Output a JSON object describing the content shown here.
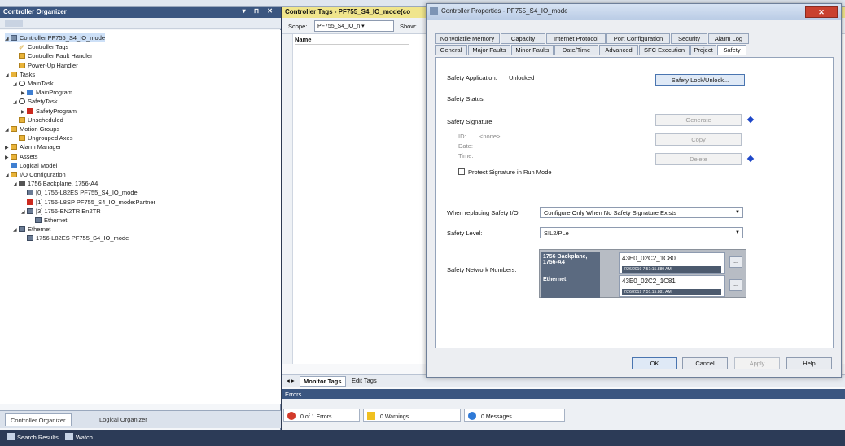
{
  "organizer": {
    "title": "Controller Organizer",
    "tree": [
      {
        "label": "Controller PF755_S4_IO_mode",
        "icon": "controller-icon",
        "level": 0,
        "expander": "◢",
        "selected": true
      },
      {
        "label": "Controller Tags",
        "icon": "tag-icon",
        "level": 1
      },
      {
        "label": "Controller Fault Handler",
        "icon": "folder-icon",
        "level": 1
      },
      {
        "label": "Power-Up Handler",
        "icon": "folder-icon",
        "level": 1
      },
      {
        "label": "Tasks",
        "icon": "folder-icon",
        "level": 0,
        "expander": "◢"
      },
      {
        "label": "MainTask",
        "icon": "task-icon",
        "level": 1,
        "expander": "◢"
      },
      {
        "label": "MainProgram",
        "icon": "program-icon",
        "level": 2,
        "expander": "▶"
      },
      {
        "label": "SafetyTask",
        "icon": "safety-task-icon",
        "level": 1,
        "expander": "◢"
      },
      {
        "label": "SafetyProgram",
        "icon": "safety-program-icon",
        "level": 2,
        "expander": "▶"
      },
      {
        "label": "Unscheduled",
        "icon": "folder-icon",
        "level": 1
      },
      {
        "label": "Motion Groups",
        "icon": "folder-icon",
        "level": 0,
        "expander": "◢"
      },
      {
        "label": "Ungrouped Axes",
        "icon": "folder-icon",
        "level": 1
      },
      {
        "label": "Alarm Manager",
        "icon": "folder-icon",
        "level": 0,
        "expander": "▶"
      },
      {
        "label": "Assets",
        "icon": "folder-icon",
        "level": 0,
        "expander": "▶"
      },
      {
        "label": "Logical Model",
        "icon": "logical-model-icon",
        "level": 0
      },
      {
        "label": "I/O Configuration",
        "icon": "folder-icon",
        "level": 0,
        "expander": "◢"
      },
      {
        "label": "1756 Backplane, 1756-A4",
        "icon": "backplane-icon",
        "level": 1,
        "expander": "◢"
      },
      {
        "label": "[0] 1756-L82ES PF755_S4_IO_mode",
        "icon": "module-icon",
        "level": 2
      },
      {
        "label": "[1] 1756-L8SP PF755_S4_IO_mode:Partner",
        "icon": "safety-module-icon",
        "level": 2
      },
      {
        "label": "[3] 1756-EN2TR En2TR",
        "icon": "module-icon",
        "level": 2,
        "expander": "◢"
      },
      {
        "label": "Ethernet",
        "icon": "ethernet-icon",
        "level": 3
      },
      {
        "label": "Ethernet",
        "icon": "ethernet-icon",
        "level": 1,
        "expander": "◢"
      },
      {
        "label": "1756-L82ES PF755_S4_IO_mode",
        "icon": "module-icon",
        "level": 2
      }
    ],
    "tabs": [
      "Controller Organizer",
      "Logical Organizer"
    ]
  },
  "statusbar": {
    "items": [
      "Search Results",
      "Watch"
    ]
  },
  "tags_window": {
    "title": "Controller Tags - PF755_S4_IO_mode(co",
    "scope_label": "Scope:",
    "scope_value": "PF755_S4_IO_n",
    "show_label": "Show:",
    "column_name": "Name",
    "tabs": [
      "Monitor Tags",
      "Edit Tags"
    ]
  },
  "errors_panel": {
    "title": "Errors",
    "errors": "0 of 1 Errors",
    "warnings": "0 Warnings",
    "messages": "0 Messages"
  },
  "dialog": {
    "title": "Controller Properties - PF755_S4_IO_mode",
    "tabs_row1": [
      "Nonvolatile Memory",
      "Capacity",
      "Internet Protocol",
      "Port Configuration",
      "Security",
      "Alarm Log"
    ],
    "tabs_row2": [
      "General",
      "Major Faults",
      "Minor Faults",
      "Date/Time",
      "Advanced",
      "SFC Execution",
      "Project",
      "Safety"
    ],
    "safety_application_label": "Safety Application:",
    "safety_application_value": "Unlocked",
    "safety_lock_button": "Safety Lock/Unlock...",
    "safety_status_label": "Safety Status:",
    "safety_signature_label": "Safety Signature:",
    "generate_button": "Generate",
    "copy_button": "Copy",
    "delete_button": "Delete",
    "id_label": "ID:",
    "id_value": "<none>",
    "date_label": "Date:",
    "time_label": "Time:",
    "protect_label": "Protect Signature in Run Mode",
    "replacing_label": "When replacing Safety I/O:",
    "replacing_value": "Configure Only When No Safety Signature Exists",
    "safety_level_label": "Safety Level:",
    "safety_level_value": "SIL2/PLe",
    "snn_label": "Safety Network Numbers:",
    "snn": [
      {
        "name": "1756 Backplane, 1756-A4",
        "number": "43E0_02C2_1C80",
        "timestamp": "7/26/2019 7:51:15.880 AM"
      },
      {
        "name": "Ethernet",
        "number": "43E0_02C2_1C81",
        "timestamp": "7/26/2019 7:51:15.881 AM"
      }
    ],
    "ok_button": "OK",
    "cancel_button": "Cancel",
    "apply_button": "Apply",
    "help_button": "Help"
  }
}
